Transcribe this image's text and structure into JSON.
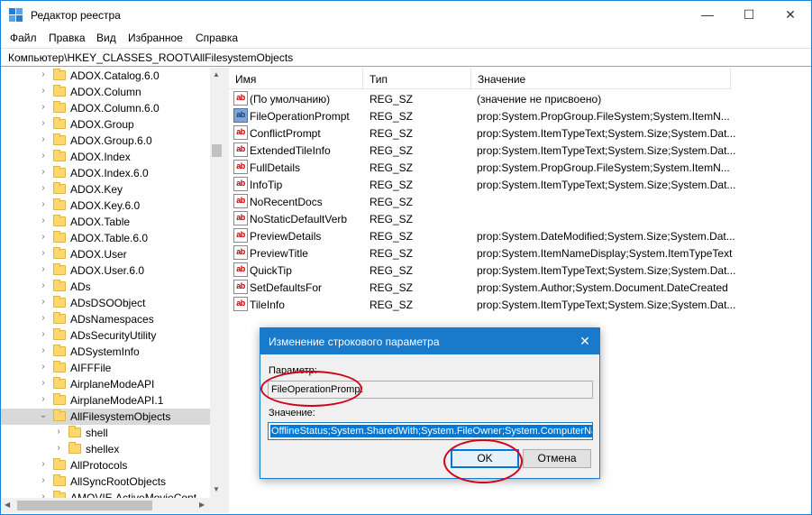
{
  "window": {
    "title": "Редактор реестра",
    "minimize": "—",
    "maximize": "☐",
    "close": "✕"
  },
  "menu": [
    "Файл",
    "Правка",
    "Вид",
    "Избранное",
    "Справка"
  ],
  "address": "Компьютер\\HKEY_CLASSES_ROOT\\AllFilesystemObjects",
  "tree": [
    {
      "label": "ADOX.Catalog.6.0",
      "expander": "›",
      "level": 0
    },
    {
      "label": "ADOX.Column",
      "expander": "›",
      "level": 0
    },
    {
      "label": "ADOX.Column.6.0",
      "expander": "›",
      "level": 0
    },
    {
      "label": "ADOX.Group",
      "expander": "›",
      "level": 0
    },
    {
      "label": "ADOX.Group.6.0",
      "expander": "›",
      "level": 0
    },
    {
      "label": "ADOX.Index",
      "expander": "›",
      "level": 0
    },
    {
      "label": "ADOX.Index.6.0",
      "expander": "›",
      "level": 0
    },
    {
      "label": "ADOX.Key",
      "expander": "›",
      "level": 0
    },
    {
      "label": "ADOX.Key.6.0",
      "expander": "›",
      "level": 0
    },
    {
      "label": "ADOX.Table",
      "expander": "›",
      "level": 0
    },
    {
      "label": "ADOX.Table.6.0",
      "expander": "›",
      "level": 0
    },
    {
      "label": "ADOX.User",
      "expander": "›",
      "level": 0
    },
    {
      "label": "ADOX.User.6.0",
      "expander": "›",
      "level": 0
    },
    {
      "label": "ADs",
      "expander": "›",
      "level": 0
    },
    {
      "label": "ADsDSOObject",
      "expander": "›",
      "level": 0
    },
    {
      "label": "ADsNamespaces",
      "expander": "›",
      "level": 0
    },
    {
      "label": "ADsSecurityUtility",
      "expander": "›",
      "level": 0
    },
    {
      "label": "ADSystemInfo",
      "expander": "›",
      "level": 0
    },
    {
      "label": "AIFFFile",
      "expander": "›",
      "level": 0
    },
    {
      "label": "AirplaneModeAPI",
      "expander": "›",
      "level": 0
    },
    {
      "label": "AirplaneModeAPI.1",
      "expander": "›",
      "level": 0
    },
    {
      "label": "AllFilesystemObjects",
      "expander": "⌄",
      "level": 0,
      "selected": true
    },
    {
      "label": "shell",
      "expander": "›",
      "level": 1
    },
    {
      "label": "shellex",
      "expander": "›",
      "level": 1
    },
    {
      "label": "AllProtocols",
      "expander": "›",
      "level": 0
    },
    {
      "label": "AllSyncRootObjects",
      "expander": "›",
      "level": 0
    },
    {
      "label": "AMOVIE.ActiveMovieCont",
      "expander": "›",
      "level": 0
    }
  ],
  "columns": [
    "Имя",
    "Тип",
    "Значение"
  ],
  "rows": [
    {
      "name": "(По умолчанию)",
      "type": "REG_SZ",
      "value": "(значение не присвоено)",
      "icon": "ab"
    },
    {
      "name": "FileOperationPrompt",
      "type": "REG_SZ",
      "value": "prop:System.PropGroup.FileSystem;System.ItemN...",
      "icon": "ab",
      "selected": true
    },
    {
      "name": "ConflictPrompt",
      "type": "REG_SZ",
      "value": "prop:System.ItemTypeText;System.Size;System.Dat...",
      "icon": "ab"
    },
    {
      "name": "ExtendedTileInfo",
      "type": "REG_SZ",
      "value": "prop:System.ItemTypeText;System.Size;System.Dat...",
      "icon": "ab"
    },
    {
      "name": "FullDetails",
      "type": "REG_SZ",
      "value": "prop:System.PropGroup.FileSystem;System.ItemN...",
      "icon": "ab"
    },
    {
      "name": "InfoTip",
      "type": "REG_SZ",
      "value": "prop:System.ItemTypeText;System.Size;System.Dat...",
      "icon": "ab"
    },
    {
      "name": "NoRecentDocs",
      "type": "REG_SZ",
      "value": "",
      "icon": "ab"
    },
    {
      "name": "NoStaticDefaultVerb",
      "type": "REG_SZ",
      "value": "",
      "icon": "ab"
    },
    {
      "name": "PreviewDetails",
      "type": "REG_SZ",
      "value": "prop:System.DateModified;System.Size;System.Dat...",
      "icon": "ab"
    },
    {
      "name": "PreviewTitle",
      "type": "REG_SZ",
      "value": "prop:System.ItemNameDisplay;System.ItemTypeText",
      "icon": "ab"
    },
    {
      "name": "QuickTip",
      "type": "REG_SZ",
      "value": "prop:System.ItemTypeText;System.Size;System.Dat...",
      "icon": "ab"
    },
    {
      "name": "SetDefaultsFor",
      "type": "REG_SZ",
      "value": "prop:System.Author;System.Document.DateCreated",
      "icon": "ab"
    },
    {
      "name": "TileInfo",
      "type": "REG_SZ",
      "value": "prop:System.ItemTypeText;System.Size;System.Dat...",
      "icon": "ab"
    }
  ],
  "dialog": {
    "title": "Изменение строкового параметра",
    "close": "✕",
    "param_label": "Параметр:",
    "param_value": "FileOperationPrompt",
    "value_label": "Значение:",
    "value_value": "OfflineStatus;System.SharedWith;System.FileOwner;System.ComputerName",
    "ok": "OK",
    "cancel": "Отмена"
  },
  "colors": {
    "accent": "#1979ca",
    "selection": "#0078d7",
    "annotation": "#d0021b"
  }
}
